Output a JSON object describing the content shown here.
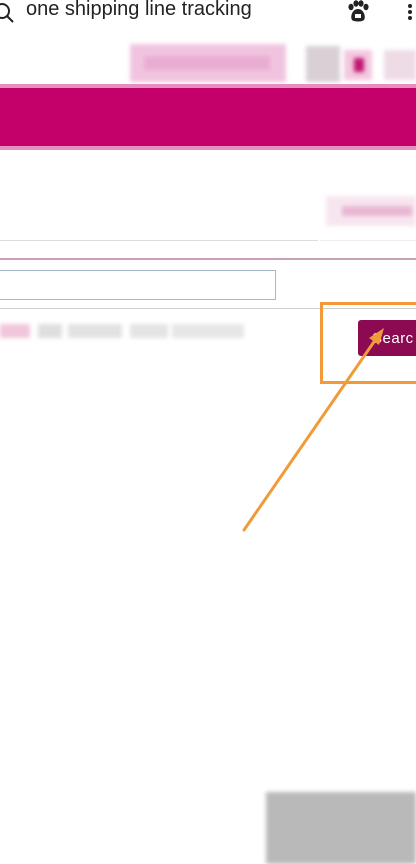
{
  "search_bar": {
    "query": "one shipping line tracking"
  },
  "icons": {
    "search": "search-icon",
    "baidu": "baidu-paw-icon",
    "more": "more-vertical-icon"
  },
  "colors": {
    "brand_magenta": "#c4006a",
    "button": "#8b0a52",
    "highlight": "#f09a3a"
  },
  "tracking_form": {
    "input_value": "",
    "search_button_label": "Searc"
  }
}
